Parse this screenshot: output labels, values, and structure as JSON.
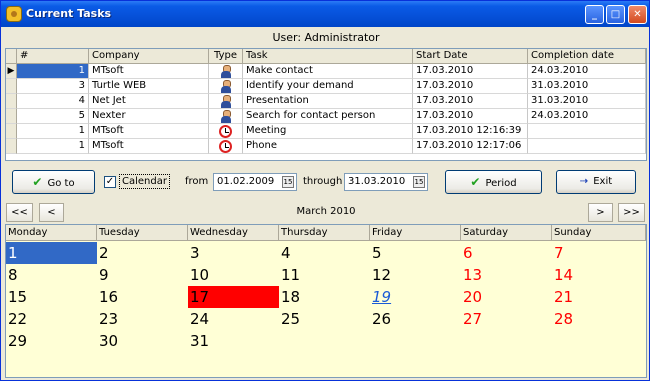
{
  "window": {
    "title": "Current Tasks"
  },
  "userbar": {
    "text": "User:  Administrator"
  },
  "table": {
    "headers": [
      "#",
      "Company",
      "Type",
      "Task",
      "Start Date",
      "Completion date"
    ],
    "rows": [
      {
        "num": "1",
        "company": "MTsoft",
        "type": "person-icon",
        "task": "Make contact",
        "start": "17.03.2010",
        "completion": "24.03.2010"
      },
      {
        "num": "3",
        "company": "Turtle WEB",
        "type": "person-icon",
        "task": "Identify your demand",
        "start": "17.03.2010",
        "completion": "31.03.2010"
      },
      {
        "num": "4",
        "company": "Net Jet",
        "type": "person-icon",
        "task": "Presentation",
        "start": "17.03.2010",
        "completion": "31.03.2010"
      },
      {
        "num": "5",
        "company": "Nexter",
        "type": "person-icon",
        "task": "Search for contact person",
        "start": "17.03.2010",
        "completion": "24.03.2010"
      },
      {
        "num": "1",
        "company": "MTsoft",
        "type": "clock-icon",
        "task": "Meeting",
        "start": "17.03.2010 12:16:39",
        "completion": ""
      },
      {
        "num": "1",
        "company": "MTsoft",
        "type": "clock-icon",
        "task": "Phone",
        "start": "17.03.2010 12:17:06",
        "completion": ""
      }
    ]
  },
  "toolbar": {
    "goto_label": "Go to",
    "calendar_label": "Calendar",
    "calendar_checked": "✓",
    "from_label": "from",
    "from_value": "01.02.2009",
    "through_label": "through",
    "through_value": "31.03.2010",
    "period_label": "Period",
    "exit_label": "Exit",
    "dropdown_glyph": "15"
  },
  "calendar": {
    "month_title": "March  2010",
    "nav": {
      "first": "<<",
      "prev": "<",
      "next": ">",
      "last": ">>"
    },
    "day_headers": [
      "Monday",
      "Tuesday",
      "Wednesday",
      "Thursday",
      "Friday",
      "Saturday",
      "Sunday"
    ],
    "weeks": [
      [
        "1",
        "2",
        "3",
        "4",
        "5",
        "6",
        "7"
      ],
      [
        "8",
        "9",
        "10",
        "11",
        "12",
        "13",
        "14"
      ],
      [
        "15",
        "16",
        "17",
        "18",
        "19",
        "20",
        "21"
      ],
      [
        "22",
        "23",
        "24",
        "25",
        "26",
        "27",
        "28"
      ],
      [
        "29",
        "30",
        "31",
        "",
        "",
        "",
        ""
      ]
    ],
    "selected_day": "1",
    "today": "17",
    "linked_day": "19",
    "colors": {
      "weekend": "#ff0000",
      "today_bg": "#ff0000",
      "selected_bg": "#3169C6",
      "background": "#FFFFD6"
    }
  }
}
